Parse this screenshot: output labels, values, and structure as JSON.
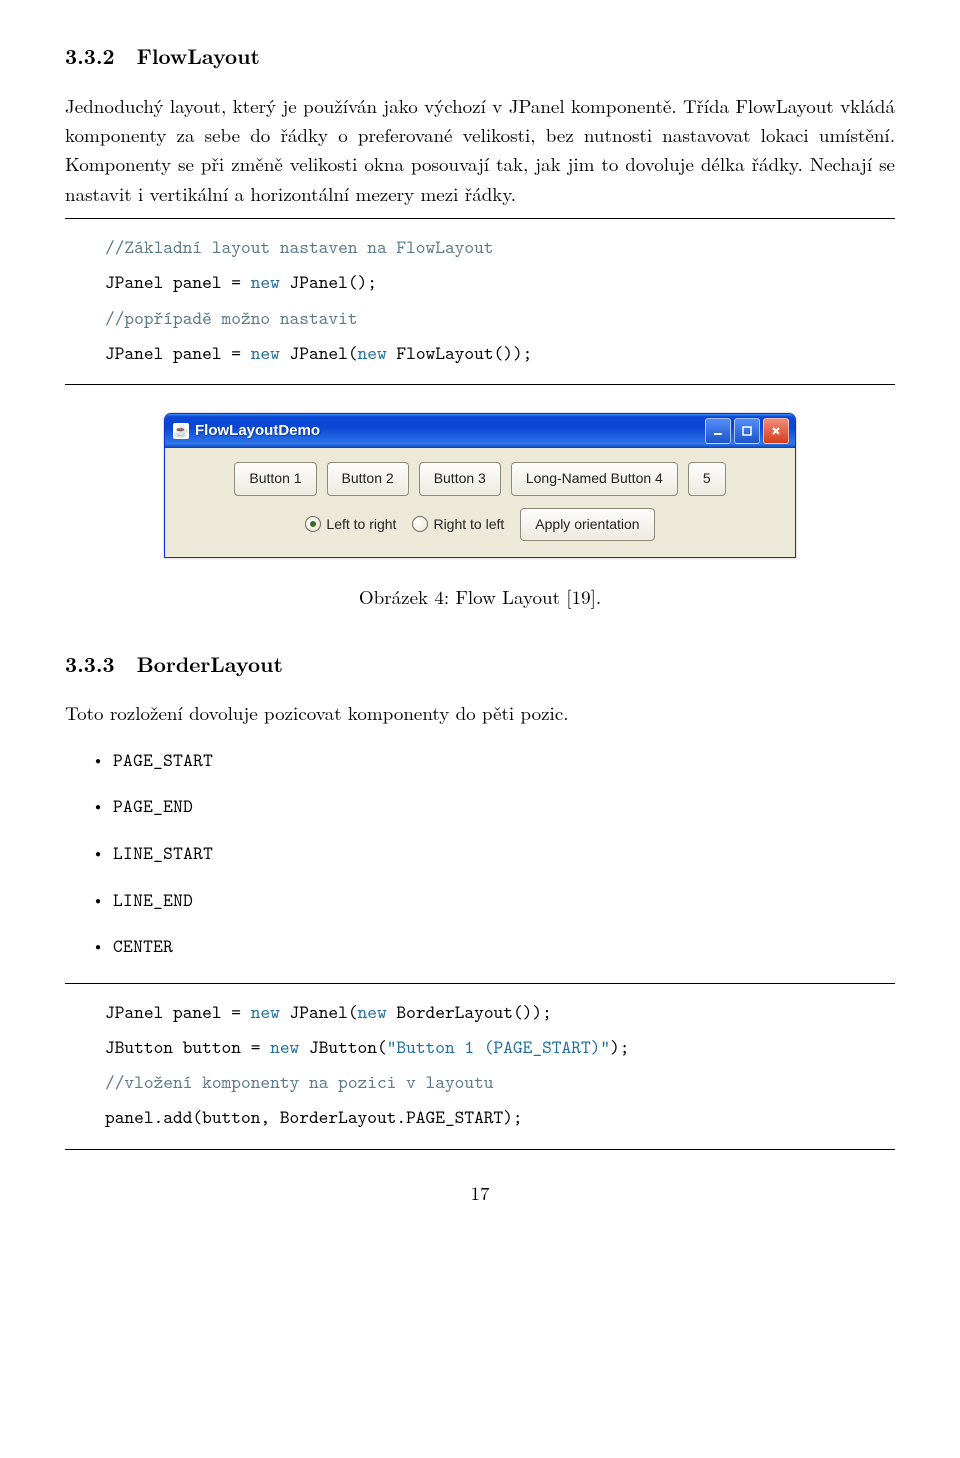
{
  "sec332": {
    "num": "3.3.2",
    "title": "FlowLayout"
  },
  "para1": "Jednoduchý layout, který je používán jako výchozí v JPanel komponentě. Třída FlowLayout vkládá komponenty za sebe do řádky o preferované velikosti, bez nutnosti nastavovat lokaci umístění. Komponenty se při změně velikosti okna posouvají tak, jak jim to dovoluje délka řádky. Nechají se nastavit i vertikální a horizontální mezery mezi řádky.",
  "code1": {
    "c1": "//Základní layout nastaven na FlowLayout",
    "l1a": "JPanel panel = ",
    "l1b": "new",
    "l1c": " JPanel();",
    "c2": "//popřípadě možno nastavit",
    "l2a": "JPanel panel = ",
    "l2b": "new",
    "l2c": " JPanel(",
    "l2d": "new",
    "l2e": " FlowLayout());"
  },
  "window": {
    "title": "FlowLayoutDemo",
    "b1": "Button 1",
    "b2": "Button 2",
    "b3": "Button 3",
    "b4": "Long-Named Button 4",
    "b5": "5",
    "r1": "Left to right",
    "r2": "Right to left",
    "apply": "Apply orientation"
  },
  "caption": "Obrázek 4: Flow Layout [19].",
  "sec333": {
    "num": "3.3.3",
    "title": "BorderLayout"
  },
  "para2": "Toto rozložení dovoluje pozicovat komponenty do pěti pozic.",
  "list": {
    "i1": "PAGE_START",
    "i2": "PAGE_END",
    "i3": "LINE_START",
    "i4": "LINE_END",
    "i5": "CENTER"
  },
  "code2": {
    "l1a": "JPanel panel = ",
    "l1b": "new",
    "l1c": " JPanel(",
    "l1d": "new",
    "l1e": " BorderLayout());",
    "l2a": "JButton button = ",
    "l2b": "new",
    "l2c": " JButton(",
    "l2d": "\"Button 1 (PAGE_START)\"",
    "l2e": ");",
    "c1": "//vložení komponenty na pozici v layoutu",
    "l3": "panel.add(button, BorderLayout.PAGE_START);"
  },
  "pagenum": "17"
}
